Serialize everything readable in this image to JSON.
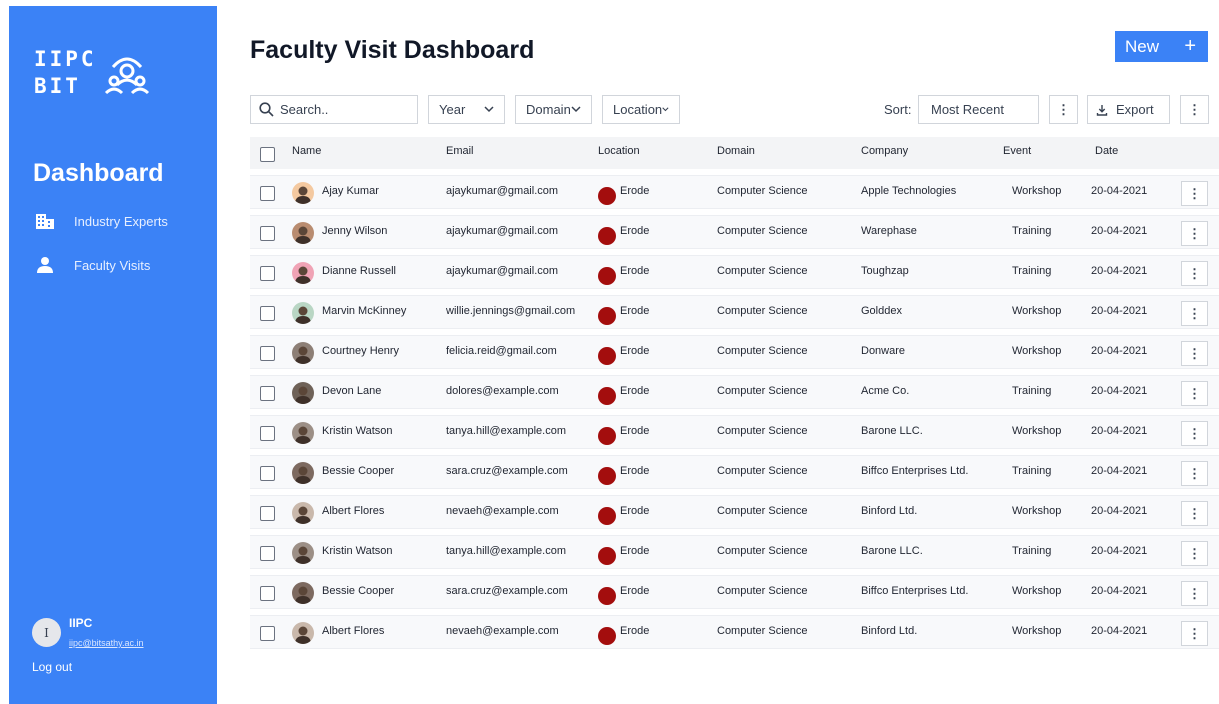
{
  "sidebar": {
    "logo_line1": "IIPC",
    "logo_line2": "BIT",
    "dashboard_title": "Dashboard",
    "nav": [
      {
        "label": "Industry Experts",
        "icon": "building-icon"
      },
      {
        "label": "Faculty Visits",
        "icon": "person-icon"
      }
    ],
    "user": {
      "initial": "I",
      "name": "IIPC",
      "email": "iipc@bitsathy.ac.in"
    },
    "logout_label": "Log out"
  },
  "header": {
    "title": "Faculty Visit Dashboard",
    "new_label": "New",
    "new_icon": "plus-icon"
  },
  "toolbar": {
    "search_placeholder": "Search..",
    "filters": [
      "Year",
      "Domain",
      "Location"
    ],
    "sort_label": "Sort:",
    "sort_value": "Most Recent",
    "export_label": "Export"
  },
  "table": {
    "columns": [
      "Name",
      "Email",
      "Location",
      "Domain",
      "Company",
      "Event",
      "Date"
    ],
    "rows": [
      {
        "name": "Ajay Kumar",
        "email": "ajaykumar@gmail.com",
        "location": "Erode",
        "domain": "Computer Science",
        "company": "Apple Technologies",
        "event": "Workshop",
        "date": "20-04-2021",
        "avatar_color": "#f4c9a0"
      },
      {
        "name": "Jenny Wilson",
        "email": "ajaykumar@gmail.com",
        "location": "Erode",
        "domain": "Computer Science",
        "company": "Warephase",
        "event": "Training",
        "date": "20-04-2021",
        "avatar_color": "#b98c70"
      },
      {
        "name": "Dianne Russell",
        "email": "ajaykumar@gmail.com",
        "location": "Erode",
        "domain": "Computer Science",
        "company": "Toughzap",
        "event": "Training",
        "date": "20-04-2021",
        "avatar_color": "#f0a3b5"
      },
      {
        "name": "Marvin McKinney",
        "email": "willie.jennings@gmail.com",
        "location": "Erode",
        "domain": "Computer Science",
        "company": "Golddex",
        "event": "Workshop",
        "date": "20-04-2021",
        "avatar_color": "#b9d6c4"
      },
      {
        "name": "Courtney Henry",
        "email": "felicia.reid@gmail.com",
        "location": "Erode",
        "domain": "Computer Science",
        "company": "Donware",
        "event": "Workshop",
        "date": "20-04-2021",
        "avatar_color": "#8d7f76"
      },
      {
        "name": "Devon Lane",
        "email": "dolores@example.com",
        "location": "Erode",
        "domain": "Computer Science",
        "company": "Acme Co.",
        "event": "Training",
        "date": "20-04-2021",
        "avatar_color": "#6f6258"
      },
      {
        "name": "Kristin Watson",
        "email": "tanya.hill@example.com",
        "location": "Erode",
        "domain": "Computer Science",
        "company": "Barone LLC.",
        "event": "Workshop",
        "date": "20-04-2021",
        "avatar_color": "#9c8f86"
      },
      {
        "name": "Bessie Cooper",
        "email": "sara.cruz@example.com",
        "location": "Erode",
        "domain": "Computer Science",
        "company": "Biffco Enterprises Ltd.",
        "event": "Training",
        "date": "20-04-2021",
        "avatar_color": "#7d6a60"
      },
      {
        "name": "Albert Flores",
        "email": "nevaeh@example.com",
        "location": "Erode",
        "domain": "Computer Science",
        "company": "Binford Ltd.",
        "event": "Workshop",
        "date": "20-04-2021",
        "avatar_color": "#c9b8ab"
      },
      {
        "name": "Kristin Watson",
        "email": "tanya.hill@example.com",
        "location": "Erode",
        "domain": "Computer Science",
        "company": "Barone LLC.",
        "event": "Training",
        "date": "20-04-2021",
        "avatar_color": "#9c8f86"
      },
      {
        "name": "Bessie Cooper",
        "email": "sara.cruz@example.com",
        "location": "Erode",
        "domain": "Computer Science",
        "company": "Biffco Enterprises Ltd.",
        "event": "Workshop",
        "date": "20-04-2021",
        "avatar_color": "#7d6a60"
      },
      {
        "name": "Albert Flores",
        "email": "nevaeh@example.com",
        "location": "Erode",
        "domain": "Computer Science",
        "company": "Binford Ltd.",
        "event": "Workshop",
        "date": "20-04-2021",
        "avatar_color": "#c9b8ab"
      }
    ]
  },
  "colors": {
    "accent": "#3b82f6",
    "location_dot": "#a30d0d"
  }
}
